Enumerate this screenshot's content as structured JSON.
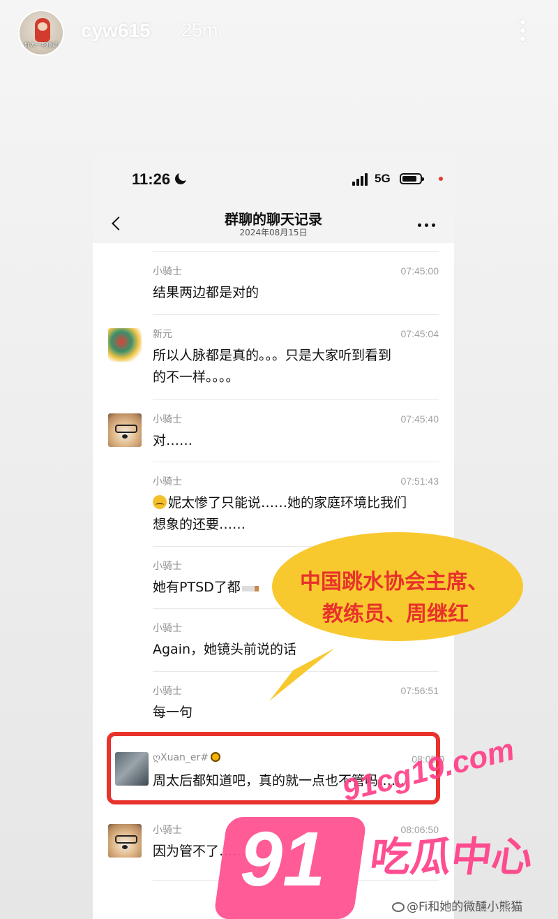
{
  "story": {
    "avatar_text": "好大一坨傻逼",
    "username": "cyw615",
    "time_ago": "25m"
  },
  "status_bar": {
    "time": "11:26",
    "network": "5G"
  },
  "nav": {
    "title": "群聊的聊天记录",
    "subtitle": "2024年08月15日"
  },
  "messages": [
    {
      "name": "小骑士",
      "time": "07:45:00",
      "text": "结果两边都是对的"
    },
    {
      "name": "新元",
      "time": "07:45:04",
      "text_line1": "所以人脉都是真的。。。只是大家听到看到",
      "text_line2": "的不一样。。。。"
    },
    {
      "name": "小骑士",
      "time": "07:45:40",
      "text": "对……"
    },
    {
      "name": "小骑士",
      "time": "07:51:43",
      "text_line1": "妮太惨了只能说……她的家庭环境比我们",
      "text_line2": "想象的还要……"
    },
    {
      "name": "小骑士",
      "time": "",
      "text": "她有PTSD了都"
    },
    {
      "name": "小骑士",
      "time": "",
      "text": "Again，她镜头前说的话"
    },
    {
      "name": "小骑士",
      "time": "07:56:51",
      "text": "每一句"
    },
    {
      "name": "ღXuan_er#",
      "time": "08:05:0",
      "text": "周太后都知道吧，真的就一点也不管吗……"
    },
    {
      "name": "小骑士",
      "time": "08:06:50",
      "text": "因为管不了……"
    }
  ],
  "callout": {
    "line1": "中国跳水协会主席、",
    "line2": "教练员、周继红"
  },
  "watermark": {
    "url": "91cg19.com",
    "number": "91",
    "title": "吃瓜中心"
  },
  "credit": "@Fi和她的微醺小熊猫",
  "colors": {
    "highlight": "#e8322b",
    "bubble": "#f8c92f",
    "watermark": "#ff3f88"
  }
}
